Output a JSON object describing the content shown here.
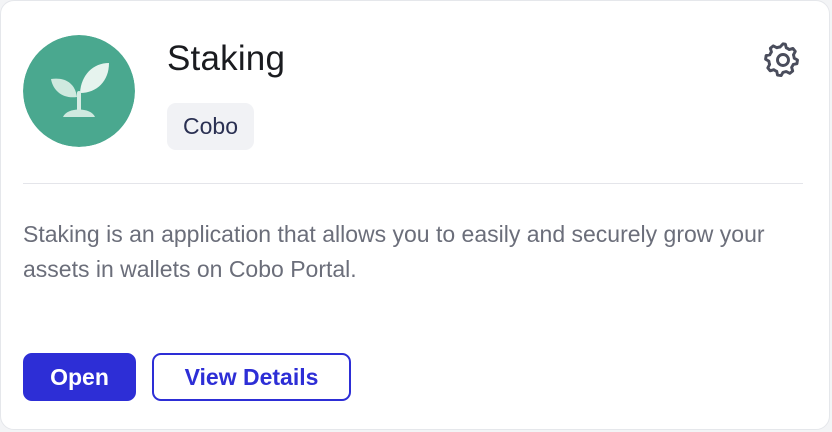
{
  "app": {
    "name": "Staking",
    "provider_tag": "Cobo",
    "description": "Staking is an application that allows you to easily and securely grow your assets in wallets on Cobo Portal.",
    "logo_icon": "sprout-icon",
    "settings_icon": "gear-icon"
  },
  "actions": {
    "open_label": "Open",
    "details_label": "View Details"
  },
  "colors": {
    "accent": "#2d2ed6",
    "logo_bg": "#4aa88f",
    "tag_bg": "#f1f2f5",
    "title": "#1a1b1f",
    "description": "#6b6e7a"
  }
}
